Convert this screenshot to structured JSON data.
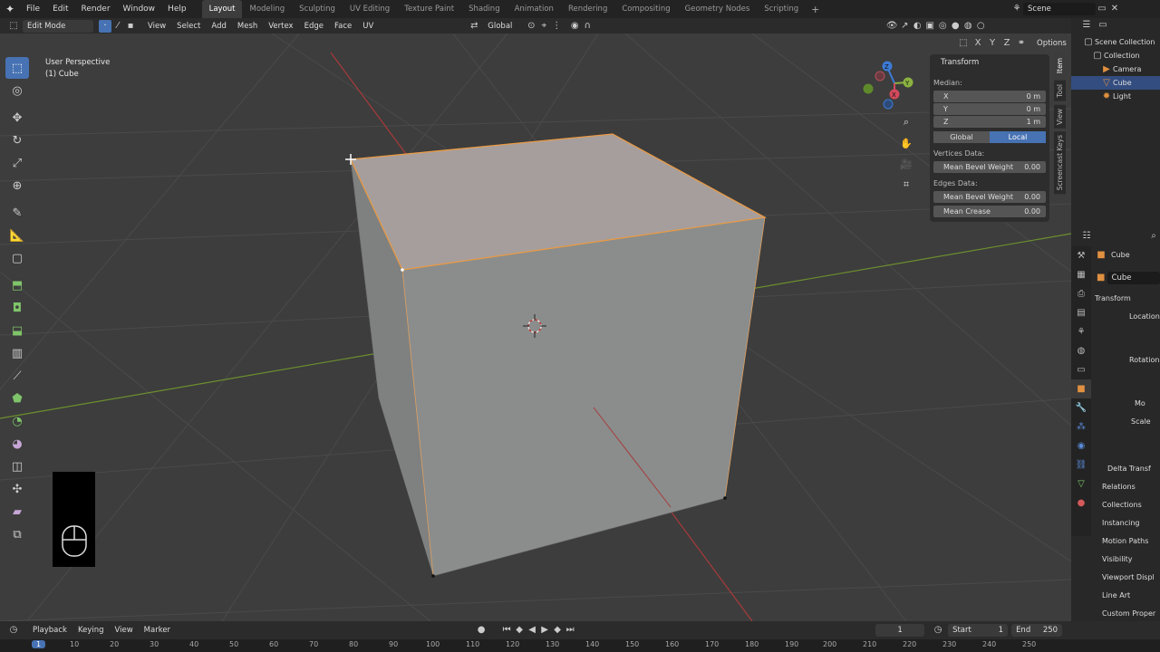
{
  "topbar": {
    "menus": [
      "File",
      "Edit",
      "Render",
      "Window",
      "Help"
    ],
    "workspaces": [
      "Layout",
      "Modeling",
      "Sculpting",
      "UV Editing",
      "Texture Paint",
      "Shading",
      "Animation",
      "Rendering",
      "Compositing",
      "Geometry Nodes",
      "Scripting"
    ],
    "active_workspace": "Layout",
    "scene": "Scene"
  },
  "viewport_header": {
    "mode": "Edit Mode",
    "menus": [
      "View",
      "Select",
      "Add",
      "Mesh",
      "Vertex",
      "Edge",
      "Face",
      "UV"
    ],
    "orientation": "Global",
    "options": "Options",
    "axes": [
      "X",
      "Y",
      "Z"
    ]
  },
  "viewport": {
    "perspective": "User Perspective",
    "object": "(1) Cube"
  },
  "npanel": {
    "title": "Transform",
    "median_label": "Median:",
    "x_label": "X",
    "x_value": "0 m",
    "y_label": "Y",
    "y_value": "0 m",
    "z_label": "Z",
    "z_value": "1 m",
    "global": "Global",
    "local": "Local",
    "vertices_label": "Vertices Data:",
    "v_bevel_label": "Mean Bevel Weight",
    "v_bevel_value": "0.00",
    "edges_label": "Edges Data:",
    "e_bevel_label": "Mean Bevel Weight",
    "e_bevel_value": "0.00",
    "e_crease_label": "Mean Crease",
    "e_crease_value": "0.00",
    "tabs": [
      "Item",
      "Tool",
      "View",
      "Screencast Keys"
    ]
  },
  "outliner": {
    "root": "Scene Collection",
    "collection": "Collection",
    "items": [
      "Camera",
      "Cube",
      "Light"
    ]
  },
  "properties": {
    "object_name": "Cube",
    "data_name": "Cube",
    "transform": "Transform",
    "location": "Location",
    "rotation": "Rotation",
    "mode": "Mo",
    "scale": "Scale",
    "delta": "Delta Transf",
    "sections": [
      "Relations",
      "Collections",
      "Instancing",
      "Motion Paths",
      "Visibility",
      "Viewport Displ",
      "Line Art",
      "Custom Proper"
    ]
  },
  "timeline": {
    "menus": [
      "Playback",
      "Keying",
      "View",
      "Marker"
    ],
    "current_frame": "1",
    "start_label": "Start",
    "start": "1",
    "end_label": "End",
    "end": "250",
    "ruler": [
      "1",
      "10",
      "20",
      "30",
      "40",
      "50",
      "60",
      "70",
      "80",
      "90",
      "100",
      "110",
      "120",
      "130",
      "140",
      "150",
      "160",
      "170",
      "180",
      "190",
      "200",
      "210",
      "220",
      "230",
      "240",
      "250"
    ]
  },
  "colors": {
    "accent": "#4772b3",
    "viewport_bg": "#3d3d3d",
    "selected_face": "#a6a09e",
    "side_face": "#8c8f8e",
    "edge_select": "#e89a46"
  }
}
